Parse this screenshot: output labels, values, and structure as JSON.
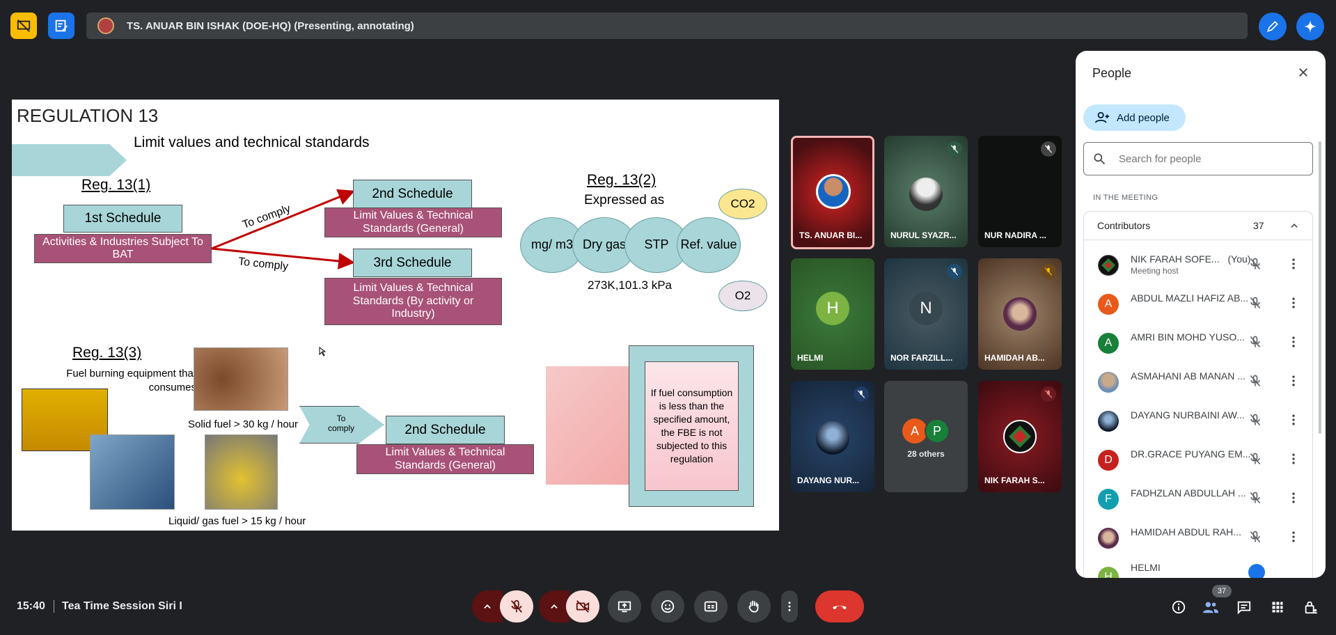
{
  "top": {
    "presenter_text": "TS. ANUAR BIN ISHAK (DOE-HQ) (Presenting, annotating)"
  },
  "slide": {
    "title": "REGULATION 13",
    "subtitle": "Limit values and technical standards",
    "reg131": "Reg. 13(1)",
    "first_schedule": "1st Schedule",
    "activities": "Activities & Industries Subject To BAT",
    "to_comply_1": "To comply",
    "to_comply_2": "To comply",
    "second_schedule_a": "2nd Schedule",
    "lv_general_a": "Limit Values & Technical Standards (General)",
    "third_schedule": "3rd Schedule",
    "lv_activity": "Limit Values & Technical Standards (By activity or Industry)",
    "reg132": "Reg. 13(2)",
    "expressed_as": "Expressed as",
    "co2": "CO2",
    "o2": "O2",
    "mg_m3": "mg/ m3",
    "dry_gas": "Dry gas",
    "stp": "STP",
    "ref_value": "Ref. value",
    "stp_values": "273K,101.3 kPa",
    "reg133": "Reg. 13(3)",
    "fuel_burning": "Fuel burning equipment that consumes",
    "solid_fuel": "Solid fuel > 30 kg / hour",
    "to_comply_3": "To comply",
    "second_schedule_b": "2nd Schedule",
    "lv_general_b": "Limit Values & Technical Standards (General)",
    "liquid_fuel": "Liquid/ gas fuel > 15 kg / hour",
    "note": "If fuel consumption is less than the specified amount, the FBE is not subjected to this regulation"
  },
  "tiles": [
    {
      "name": "TS. ANUAR BI..."
    },
    {
      "name": "NURUL SYAZR..."
    },
    {
      "name": "NUR NADIRA ..."
    },
    {
      "name": "HELMI",
      "initial": "H"
    },
    {
      "name": "NOR FARZILL...",
      "initial": "N"
    },
    {
      "name": "HAMIDAH AB..."
    },
    {
      "name": "DAYANG NUR..."
    },
    {
      "name": "28 others",
      "a": "A",
      "p": "P"
    },
    {
      "name": "NIK FARAH S..."
    }
  ],
  "panel": {
    "title": "People",
    "add_people": "Add people",
    "search_placeholder": "Search for people",
    "section": "IN THE MEETING",
    "contributors": "Contributors",
    "count": "37",
    "people": [
      {
        "name": "NIK FARAH SOFE...",
        "you": "(You)",
        "sub": "Meeting host"
      },
      {
        "name": "ABDUL MAZLI HAFIZ AB...",
        "initial": "A",
        "color": "#e8591a"
      },
      {
        "name": "AMRI BIN MOHD YUSO...",
        "initial": "A",
        "color": "#188038"
      },
      {
        "name": "ASMAHANI AB MANAN ...",
        "initial": ""
      },
      {
        "name": "DAYANG NURBAINI AW...",
        "initial": ""
      },
      {
        "name": "DR.GRACE PUYANG EM...",
        "initial": "D",
        "color": "#c5221f"
      },
      {
        "name": "FADHZLAN ABDULLAH ...",
        "initial": "F",
        "color": "#129eaf"
      },
      {
        "name": "HAMIDAH ABDUL RAH...",
        "initial": ""
      },
      {
        "name": "HELMI",
        "initial": "H",
        "color": "#7cb342"
      }
    ]
  },
  "bottom": {
    "time": "15:40",
    "meeting": "Tea Time Session Siri I",
    "people_badge": "37"
  }
}
